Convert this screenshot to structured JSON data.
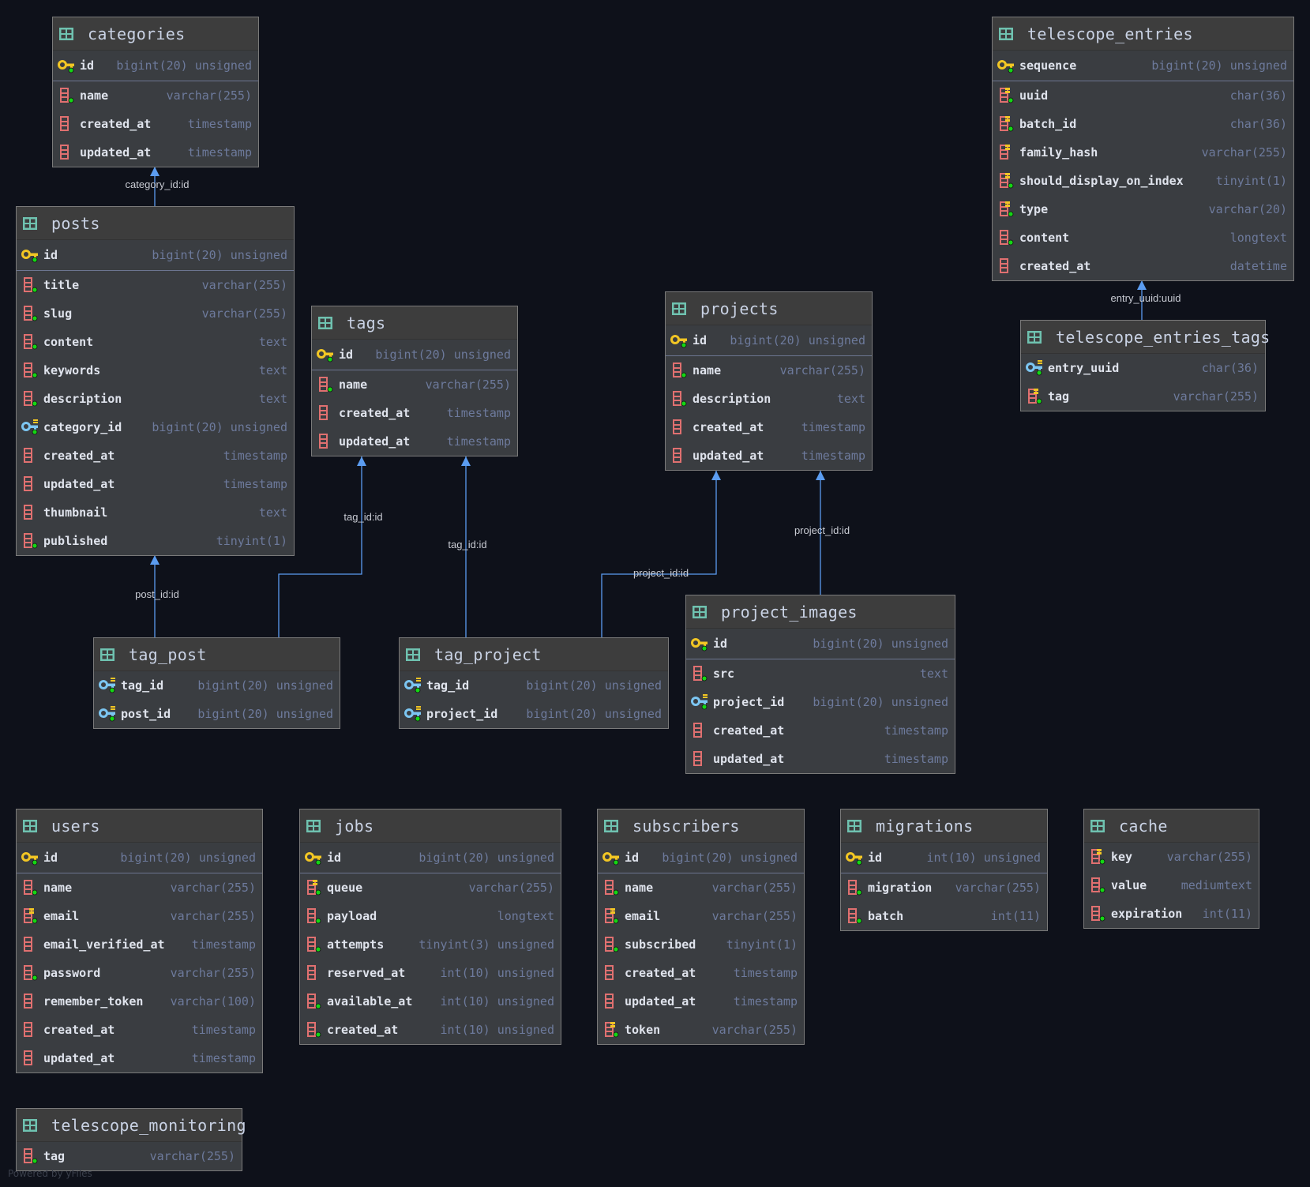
{
  "colors": {
    "background": "#0e111a",
    "edge": "#5b9cf0",
    "table_icon": "#6fc2b0",
    "pk_key": "#f2c624",
    "fk_key": "#7cc6f2",
    "column": "#e07070",
    "index_mark": "#f2c624",
    "not_null_dot": "#14d614"
  },
  "tables": [
    {
      "name": "categories",
      "pk": [
        {
          "name": "id",
          "type": "bigint(20) unsigned",
          "icon": "key",
          "notnull": true
        }
      ],
      "columns": [
        {
          "name": "name",
          "type": "varchar(255)",
          "icon": "column",
          "notnull": true
        },
        {
          "name": "created_at",
          "type": "timestamp",
          "icon": "column",
          "notnull": false
        },
        {
          "name": "updated_at",
          "type": "timestamp",
          "icon": "column",
          "notnull": false
        }
      ]
    },
    {
      "name": "posts",
      "pk": [
        {
          "name": "id",
          "type": "bigint(20) unsigned",
          "icon": "key",
          "notnull": true
        }
      ],
      "columns": [
        {
          "name": "title",
          "type": "varchar(255)",
          "icon": "column",
          "notnull": true
        },
        {
          "name": "slug",
          "type": "varchar(255)",
          "icon": "column",
          "notnull": true
        },
        {
          "name": "content",
          "type": "text",
          "icon": "column",
          "notnull": true
        },
        {
          "name": "keywords",
          "type": "text",
          "icon": "column",
          "notnull": true
        },
        {
          "name": "description",
          "type": "text",
          "icon": "column",
          "notnull": true
        },
        {
          "name": "category_id",
          "type": "bigint(20) unsigned",
          "icon": "fk-key",
          "notnull": true
        },
        {
          "name": "created_at",
          "type": "timestamp",
          "icon": "column",
          "notnull": false
        },
        {
          "name": "updated_at",
          "type": "timestamp",
          "icon": "column",
          "notnull": false
        },
        {
          "name": "thumbnail",
          "type": "text",
          "icon": "column",
          "notnull": false
        },
        {
          "name": "published",
          "type": "tinyint(1)",
          "icon": "column",
          "notnull": true
        }
      ]
    },
    {
      "name": "tags",
      "pk": [
        {
          "name": "id",
          "type": "bigint(20) unsigned",
          "icon": "key",
          "notnull": true
        }
      ],
      "columns": [
        {
          "name": "name",
          "type": "varchar(255)",
          "icon": "column",
          "notnull": true
        },
        {
          "name": "created_at",
          "type": "timestamp",
          "icon": "column",
          "notnull": false
        },
        {
          "name": "updated_at",
          "type": "timestamp",
          "icon": "column",
          "notnull": false
        }
      ]
    },
    {
      "name": "projects",
      "pk": [
        {
          "name": "id",
          "type": "bigint(20) unsigned",
          "icon": "key",
          "notnull": true
        }
      ],
      "columns": [
        {
          "name": "name",
          "type": "varchar(255)",
          "icon": "column",
          "notnull": true
        },
        {
          "name": "description",
          "type": "text",
          "icon": "column",
          "notnull": true
        },
        {
          "name": "created_at",
          "type": "timestamp",
          "icon": "column",
          "notnull": false
        },
        {
          "name": "updated_at",
          "type": "timestamp",
          "icon": "column",
          "notnull": false
        }
      ]
    },
    {
      "name": "telescope_entries",
      "pk": [
        {
          "name": "sequence",
          "type": "bigint(20) unsigned",
          "icon": "key",
          "notnull": true
        }
      ],
      "columns": [
        {
          "name": "uuid",
          "type": "char(36)",
          "icon": "index-column",
          "notnull": true
        },
        {
          "name": "batch_id",
          "type": "char(36)",
          "icon": "index-column",
          "notnull": true
        },
        {
          "name": "family_hash",
          "type": "varchar(255)",
          "icon": "index-column",
          "notnull": false
        },
        {
          "name": "should_display_on_index",
          "type": "tinyint(1)",
          "icon": "index-column",
          "notnull": true
        },
        {
          "name": "type",
          "type": "varchar(20)",
          "icon": "index-column",
          "notnull": true
        },
        {
          "name": "content",
          "type": "longtext",
          "icon": "column",
          "notnull": true
        },
        {
          "name": "created_at",
          "type": "datetime",
          "icon": "column",
          "notnull": false
        }
      ]
    },
    {
      "name": "telescope_entries_tags",
      "pk": [],
      "columns": [
        {
          "name": "entry_uuid",
          "type": "char(36)",
          "icon": "fk-key",
          "notnull": true
        },
        {
          "name": "tag",
          "type": "varchar(255)",
          "icon": "index-column",
          "notnull": true
        }
      ]
    },
    {
      "name": "tag_post",
      "pk": [],
      "columns": [
        {
          "name": "tag_id",
          "type": "bigint(20) unsigned",
          "icon": "fk-key",
          "notnull": true
        },
        {
          "name": "post_id",
          "type": "bigint(20) unsigned",
          "icon": "fk-key",
          "notnull": true
        }
      ]
    },
    {
      "name": "tag_project",
      "pk": [],
      "columns": [
        {
          "name": "tag_id",
          "type": "bigint(20) unsigned",
          "icon": "fk-key",
          "notnull": true
        },
        {
          "name": "project_id",
          "type": "bigint(20) unsigned",
          "icon": "fk-key",
          "notnull": true
        }
      ]
    },
    {
      "name": "project_images",
      "pk": [
        {
          "name": "id",
          "type": "bigint(20) unsigned",
          "icon": "key",
          "notnull": true
        }
      ],
      "columns": [
        {
          "name": "src",
          "type": "text",
          "icon": "column",
          "notnull": true
        },
        {
          "name": "project_id",
          "type": "bigint(20) unsigned",
          "icon": "fk-key",
          "notnull": true
        },
        {
          "name": "created_at",
          "type": "timestamp",
          "icon": "column",
          "notnull": false
        },
        {
          "name": "updated_at",
          "type": "timestamp",
          "icon": "column",
          "notnull": false
        }
      ]
    },
    {
      "name": "users",
      "pk": [
        {
          "name": "id",
          "type": "bigint(20) unsigned",
          "icon": "key",
          "notnull": true
        }
      ],
      "columns": [
        {
          "name": "name",
          "type": "varchar(255)",
          "icon": "column",
          "notnull": true
        },
        {
          "name": "email",
          "type": "varchar(255)",
          "icon": "index-column",
          "notnull": true
        },
        {
          "name": "email_verified_at",
          "type": "timestamp",
          "icon": "column",
          "notnull": false
        },
        {
          "name": "password",
          "type": "varchar(255)",
          "icon": "column",
          "notnull": true
        },
        {
          "name": "remember_token",
          "type": "varchar(100)",
          "icon": "column",
          "notnull": false
        },
        {
          "name": "created_at",
          "type": "timestamp",
          "icon": "column",
          "notnull": false
        },
        {
          "name": "updated_at",
          "type": "timestamp",
          "icon": "column",
          "notnull": false
        }
      ]
    },
    {
      "name": "jobs",
      "pk": [
        {
          "name": "id",
          "type": "bigint(20) unsigned",
          "icon": "key",
          "notnull": true
        }
      ],
      "columns": [
        {
          "name": "queue",
          "type": "varchar(255)",
          "icon": "index-column",
          "notnull": true
        },
        {
          "name": "payload",
          "type": "longtext",
          "icon": "column",
          "notnull": true
        },
        {
          "name": "attempts",
          "type": "tinyint(3) unsigned",
          "icon": "column",
          "notnull": true
        },
        {
          "name": "reserved_at",
          "type": "int(10) unsigned",
          "icon": "column",
          "notnull": false
        },
        {
          "name": "available_at",
          "type": "int(10) unsigned",
          "icon": "column",
          "notnull": true
        },
        {
          "name": "created_at",
          "type": "int(10) unsigned",
          "icon": "column",
          "notnull": true
        }
      ]
    },
    {
      "name": "subscribers",
      "pk": [
        {
          "name": "id",
          "type": "bigint(20) unsigned",
          "icon": "key",
          "notnull": true
        }
      ],
      "columns": [
        {
          "name": "name",
          "type": "varchar(255)",
          "icon": "column",
          "notnull": true
        },
        {
          "name": "email",
          "type": "varchar(255)",
          "icon": "index-column",
          "notnull": true
        },
        {
          "name": "subscribed",
          "type": "tinyint(1)",
          "icon": "column",
          "notnull": true
        },
        {
          "name": "created_at",
          "type": "timestamp",
          "icon": "column",
          "notnull": false
        },
        {
          "name": "updated_at",
          "type": "timestamp",
          "icon": "column",
          "notnull": false
        },
        {
          "name": "token",
          "type": "varchar(255)",
          "icon": "index-column",
          "notnull": true
        }
      ]
    },
    {
      "name": "migrations",
      "pk": [
        {
          "name": "id",
          "type": "int(10) unsigned",
          "icon": "key",
          "notnull": true
        }
      ],
      "columns": [
        {
          "name": "migration",
          "type": "varchar(255)",
          "icon": "column",
          "notnull": true
        },
        {
          "name": "batch",
          "type": "int(11)",
          "icon": "column",
          "notnull": true
        }
      ]
    },
    {
      "name": "cache",
      "pk": [],
      "columns": [
        {
          "name": "key",
          "type": "varchar(255)",
          "icon": "index-column",
          "notnull": true
        },
        {
          "name": "value",
          "type": "mediumtext",
          "icon": "column",
          "notnull": true
        },
        {
          "name": "expiration",
          "type": "int(11)",
          "icon": "column",
          "notnull": true
        }
      ]
    },
    {
      "name": "telescope_monitoring",
      "pk": [],
      "columns": [
        {
          "name": "tag",
          "type": "varchar(255)",
          "icon": "column",
          "notnull": true
        }
      ]
    }
  ],
  "edges": [
    {
      "from": "posts",
      "to": "categories",
      "label": "category_id:id"
    },
    {
      "from": "tag_post",
      "to": "posts",
      "label": "post_id:id"
    },
    {
      "from": "tag_post",
      "to": "tags",
      "label": "tag_id:id"
    },
    {
      "from": "tag_project",
      "to": "tags",
      "label": "tag_id:id"
    },
    {
      "from": "tag_project",
      "to": "projects",
      "label": "project_id:id"
    },
    {
      "from": "project_images",
      "to": "projects",
      "label": "project_id:id"
    },
    {
      "from": "telescope_entries_tags",
      "to": "telescope_entries",
      "label": "entry_uuid:uuid"
    }
  ],
  "footer": "Powered by yFiles"
}
